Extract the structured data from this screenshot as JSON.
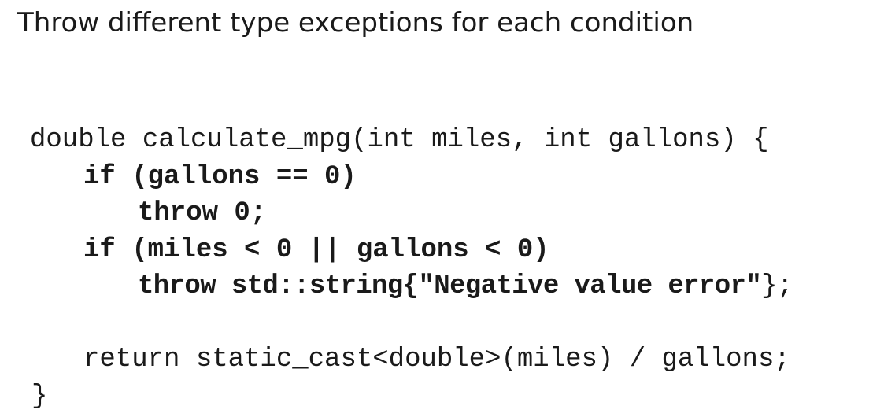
{
  "slide": {
    "title": "Throw different type exceptions for each condition"
  },
  "code": {
    "signature": "double calculate_mpg(int miles, int gallons) {",
    "if_gallons_zero": "if (gallons == 0)",
    "throw_zero": "throw 0;",
    "if_negative": "if (miles < 0 || gallons < 0)",
    "throw_string_bold": "throw std::string{\"Negative value error\"",
    "throw_string_tail": "};",
    "return_statement": "return static_cast<double>(miles) / gallons;",
    "closing_brace": "}"
  }
}
